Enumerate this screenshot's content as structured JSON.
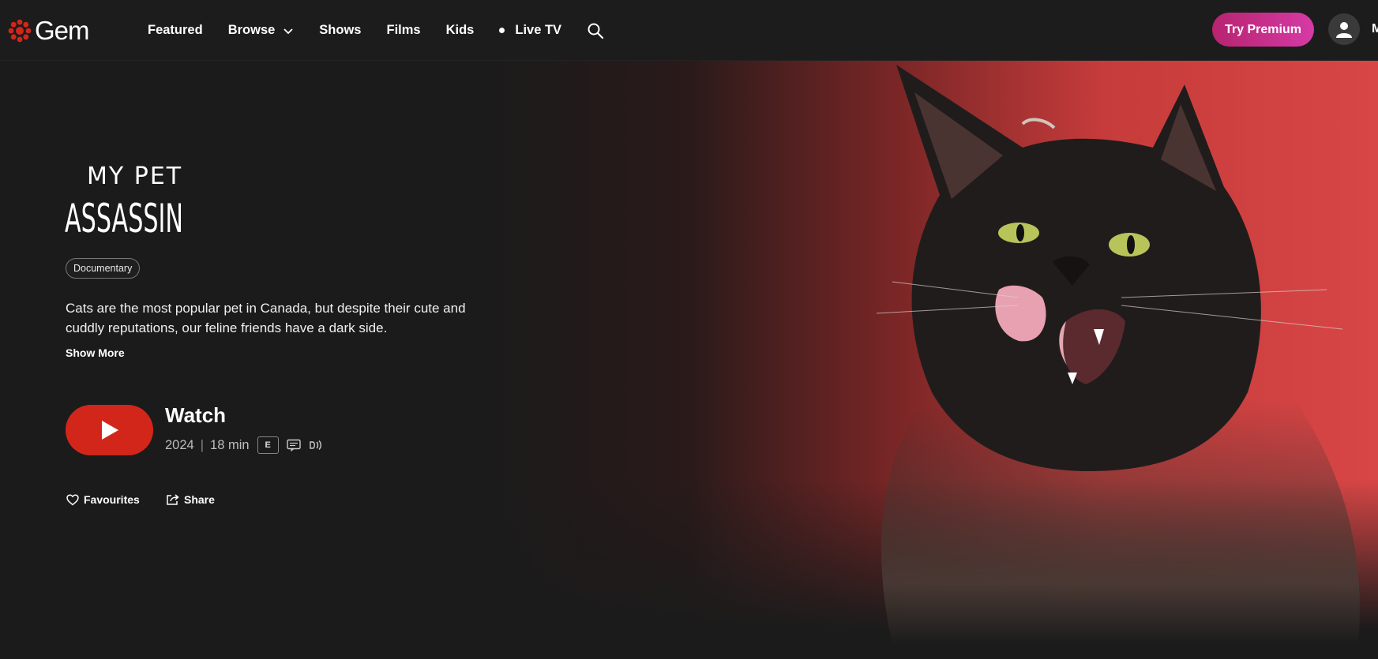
{
  "brand": {
    "name": "Gem",
    "accent": "#d3261b",
    "premium_gradient": [
      "#b6246f",
      "#d63aa6"
    ]
  },
  "nav": {
    "items": [
      {
        "label": "Featured"
      },
      {
        "label": "Browse"
      },
      {
        "label": "Shows"
      },
      {
        "label": "Films"
      },
      {
        "label": "Kids"
      },
      {
        "label": "Live TV"
      }
    ],
    "try_premium": "Try Premium",
    "account_initial": "M"
  },
  "show": {
    "logo_text_line1": "MY PET",
    "logo_text_line2": "ASSASSIN",
    "genre": "Documentary",
    "description": "Cats are the most popular pet in Canada, but despite their cute and cuddly reputations, our feline friends have a dark side.",
    "show_more": "Show More",
    "watch_label": "Watch",
    "year": "2024",
    "duration": "18 min",
    "rating": "E",
    "favourites": "Favourites",
    "share": "Share"
  },
  "icons": [
    "gem-logo-icon",
    "chevron-down-icon",
    "live-dot-icon",
    "search-icon",
    "user-icon",
    "play-icon",
    "closed-captions-icon",
    "described-video-icon",
    "heart-icon",
    "share-icon"
  ]
}
